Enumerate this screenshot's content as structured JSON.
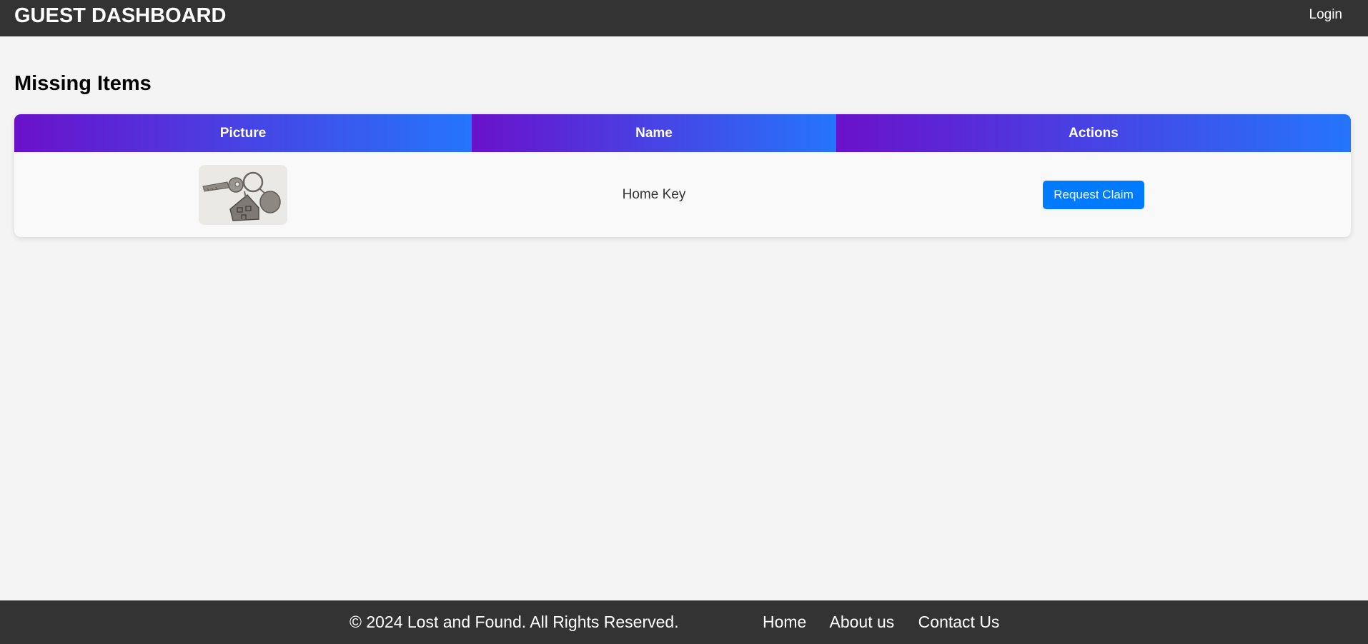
{
  "navbar": {
    "brand": "GUEST DASHBOARD",
    "login_label": "Login"
  },
  "page": {
    "title": "Missing Items"
  },
  "table": {
    "headers": [
      "Picture",
      "Name",
      "Actions"
    ],
    "rows": [
      {
        "picture_icon": "house-key-icon",
        "name": "Home Key",
        "action_label": "Request Claim"
      }
    ]
  },
  "footer": {
    "copyright": "© 2024 Lost and Found. All Rights Reserved.",
    "links": [
      "Home",
      "About us",
      "Contact Us"
    ]
  },
  "colors": {
    "header_bg": "#333333",
    "page_bg": "#f4f4f4",
    "gradient_start": "#6a11cb",
    "gradient_end": "#2575fc",
    "button_bg": "#007bff"
  }
}
